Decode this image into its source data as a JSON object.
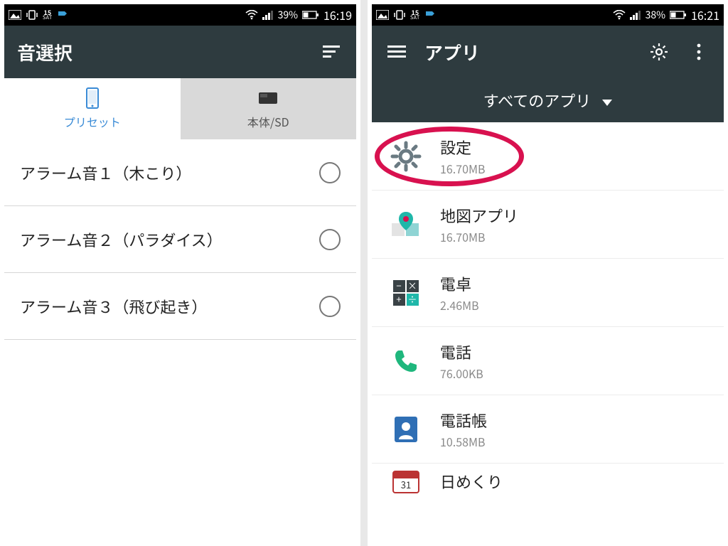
{
  "phoneA": {
    "status": {
      "cal_day": "15",
      "cal_dow": "SAT",
      "battery": "39%",
      "clock": "16:19"
    },
    "title": "音選択",
    "tabs": {
      "preset": "プリセット",
      "sd": "本体/SD"
    },
    "rows": [
      "アラーム音１（木こり）",
      "アラーム音２（パラダイス）",
      "アラーム音３（飛び起き）"
    ]
  },
  "phoneB": {
    "status": {
      "cal_day": "15",
      "cal_dow": "SAT",
      "battery": "38%",
      "clock": "16:21"
    },
    "title": "アプリ",
    "dropdown": "すべてのアプリ",
    "apps": [
      {
        "name": "設定",
        "size": "16.70MB"
      },
      {
        "name": "地図アプリ",
        "size": "16.70MB"
      },
      {
        "name": "電卓",
        "size": "2.46MB"
      },
      {
        "name": "電話",
        "size": "76.00KB"
      },
      {
        "name": "電話帳",
        "size": "10.58MB"
      },
      {
        "name": "日めくり",
        "size": ""
      }
    ]
  }
}
